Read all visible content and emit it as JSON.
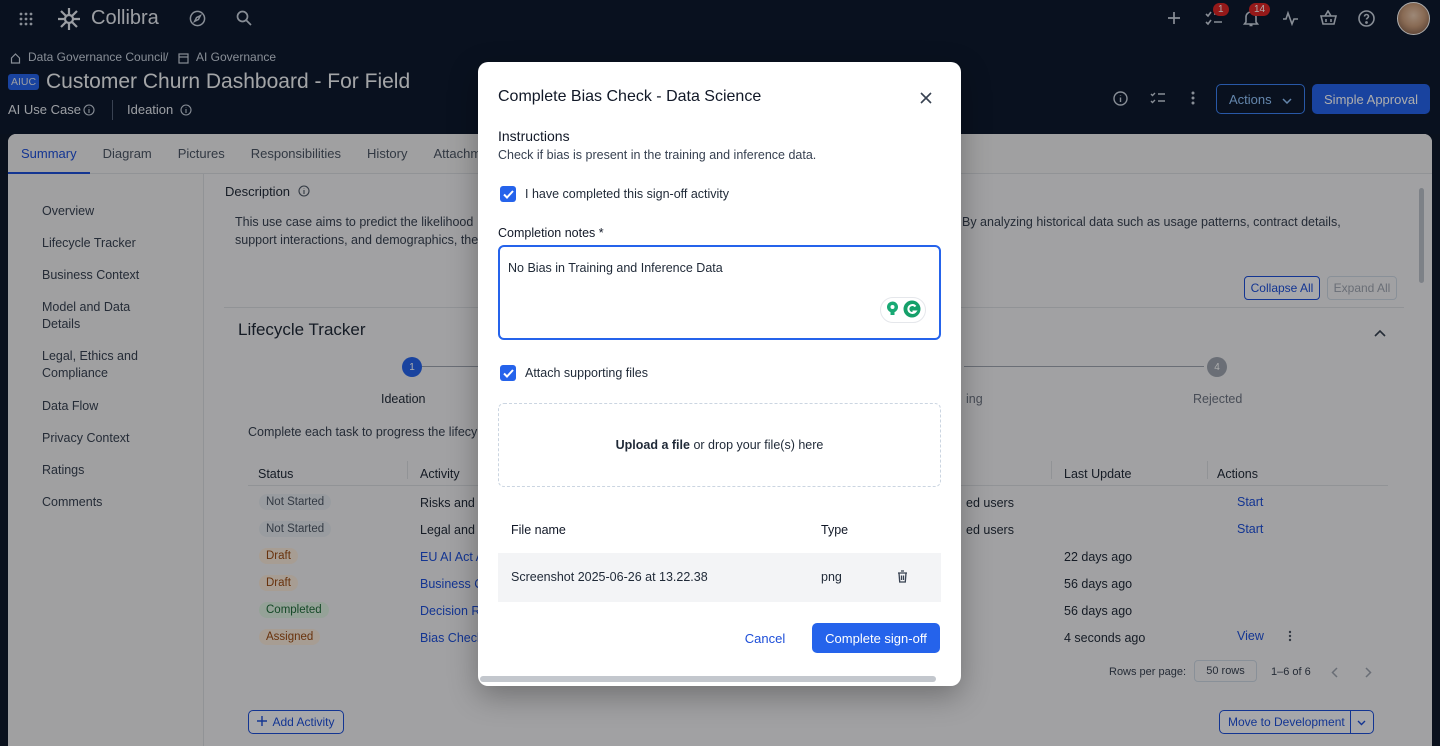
{
  "topbar": {
    "app_name": "Collibra",
    "tasks_count": "1",
    "notifications_count": "14"
  },
  "breadcrumb": {
    "parent": "Data Governance Council",
    "separator": "/",
    "current": "AI Governance"
  },
  "asset": {
    "badge": "AIUC",
    "title": "Customer Churn Dashboard - For Field",
    "type": "AI Use Case",
    "status": "Ideation"
  },
  "header_actions": {
    "actions_label": "Actions",
    "approval_label": "Simple Approval"
  },
  "tabs": [
    {
      "label": "Summary"
    },
    {
      "label": "Diagram"
    },
    {
      "label": "Pictures"
    },
    {
      "label": "Responsibilities"
    },
    {
      "label": "History"
    },
    {
      "label": "Attachm"
    }
  ],
  "sidebar": {
    "items": [
      {
        "label": "Overview"
      },
      {
        "label": "Lifecycle Tracker"
      },
      {
        "label": "Business Context"
      },
      {
        "label": "Model and Data Details"
      },
      {
        "label": "Legal, Ethics and Compliance"
      },
      {
        "label": "Data Flow"
      },
      {
        "label": "Privacy Context"
      },
      {
        "label": "Ratings"
      },
      {
        "label": "Comments"
      }
    ]
  },
  "description": {
    "heading": "Description",
    "text_left_1": "This use case aims to predict the likelihood",
    "text_right_1": "By analyzing historical data such as usage patterns, contract details,",
    "text_left_2": "support interactions, and demographics, the",
    "collapse_label": "Collapse All",
    "expand_label": "Expand All"
  },
  "lifecycle": {
    "heading": "Lifecycle Tracker",
    "step1_num": "1",
    "step1_label": "Ideation",
    "step3_partial": "ing",
    "step4_num": "4",
    "step4_label": "Rejected",
    "progress_text": "Complete each task to progress the lifecy"
  },
  "table": {
    "headers": {
      "status": "Status",
      "activity": "Activity",
      "last_update": "Last Update",
      "actions": "Actions"
    },
    "rows": [
      {
        "status": "Not Started",
        "activity": "Risks and",
        "assignee": "ed users",
        "last_update": "",
        "action": "Start"
      },
      {
        "status": "Not Started",
        "activity": "Legal and",
        "assignee": "ed users",
        "last_update": "",
        "action": "Start"
      },
      {
        "status": "Draft",
        "activity": "EU AI Act A",
        "assignee": "",
        "last_update": "22 days ago",
        "action": ""
      },
      {
        "status": "Draft",
        "activity": "Business C",
        "assignee": "",
        "last_update": "56 days ago",
        "action": ""
      },
      {
        "status": "Completed",
        "activity": "Decision R",
        "assignee": "",
        "last_update": "56 days ago",
        "action": ""
      },
      {
        "status": "Assigned",
        "activity": "Bias Check",
        "assignee": "",
        "last_update": "4 seconds ago",
        "action": "View"
      }
    ],
    "rows_per_page_label": "Rows per page:",
    "rows_per_page_value": "50 rows",
    "pagination": "1–6 of 6"
  },
  "footer": {
    "add_activity": "Add Activity",
    "move_label": "Move to Development"
  },
  "colors": {
    "primary": "#2563eb",
    "nav_bg": "#0e1a2e",
    "badge_red": "#dc2626"
  },
  "modal": {
    "title": "Complete Bias Check - Data Science",
    "instructions_heading": "Instructions",
    "instructions_text": "Check if bias is present in the training and inference data.",
    "signoff_checkbox_label": "I have completed this sign-off activity",
    "notes_label": "Completion notes *",
    "notes_value": "No Bias in Training and Inference Data",
    "attach_checkbox_label": "Attach supporting files",
    "upload_link": "Upload a file",
    "upload_rest": " or drop your file(s) here",
    "files_headers": {
      "name": "File name",
      "type": "Type"
    },
    "files": [
      {
        "name": "Screenshot 2025-06-26 at 13.22.38",
        "type": "png"
      }
    ],
    "cancel_label": "Cancel",
    "submit_label": "Complete sign-off"
  }
}
